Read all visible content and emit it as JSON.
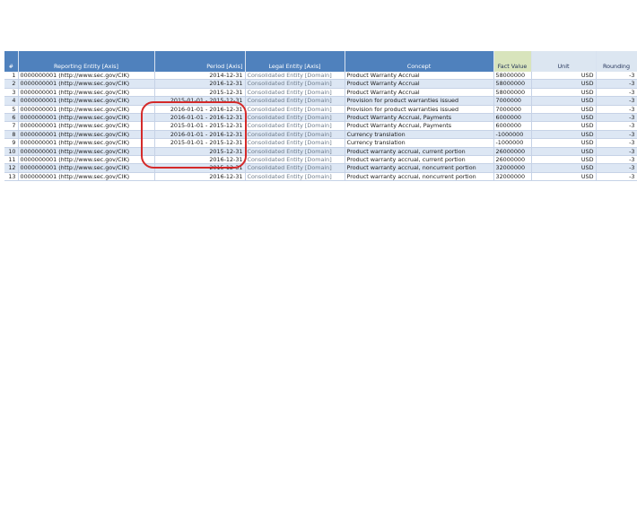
{
  "table": {
    "headers": [
      "#",
      "Reporting Entity [Axis]",
      "Period [Axis]",
      "Legal Entity [Axis]",
      "Concept",
      "Fact Value",
      "Unit",
      "Rounding"
    ],
    "rows": [
      {
        "n": "1",
        "entity": "0000000001 (http://www.sec.gov/CIK)",
        "period": "2014-12-31",
        "legal": "Consolidated Entity [Domain]",
        "concept": "Product Warranty Accrual",
        "value": "58000000",
        "unit": "USD",
        "rounding": "-3"
      },
      {
        "n": "2",
        "entity": "0000000001 (http://www.sec.gov/CIK)",
        "period": "2016-12-31",
        "legal": "Consolidated Entity [Domain]",
        "concept": "Product Warranty Accrual",
        "value": "58000000",
        "unit": "USD",
        "rounding": "-3"
      },
      {
        "n": "3",
        "entity": "0000000001 (http://www.sec.gov/CIK)",
        "period": "2015-12-31",
        "legal": "Consolidated Entity [Domain]",
        "concept": "Product Warranty Accrual",
        "value": "58000000",
        "unit": "USD",
        "rounding": "-3"
      },
      {
        "n": "4",
        "entity": "0000000001 (http://www.sec.gov/CIK)",
        "period": "2015-01-01 - 2015-12-31",
        "legal": "Consolidated Entity [Domain]",
        "concept": "Provision for product warranties issued",
        "value": "7000000",
        "unit": "USD",
        "rounding": "-3"
      },
      {
        "n": "5",
        "entity": "0000000001 (http://www.sec.gov/CIK)",
        "period": "2016-01-01 - 2016-12-31",
        "legal": "Consolidated Entity [Domain]",
        "concept": "Provision for product warranties issued",
        "value": "7000000",
        "unit": "USD",
        "rounding": "-3"
      },
      {
        "n": "6",
        "entity": "0000000001 (http://www.sec.gov/CIK)",
        "period": "2016-01-01 - 2016-12-31",
        "legal": "Consolidated Entity [Domain]",
        "concept": "Product Warranty Accrual, Payments",
        "value": "6000000",
        "unit": "USD",
        "rounding": "-3"
      },
      {
        "n": "7",
        "entity": "0000000001 (http://www.sec.gov/CIK)",
        "period": "2015-01-01 - 2015-12-31",
        "legal": "Consolidated Entity [Domain]",
        "concept": "Product Warranty Accrual, Payments",
        "value": "6000000",
        "unit": "USD",
        "rounding": "-3"
      },
      {
        "n": "8",
        "entity": "0000000001 (http://www.sec.gov/CIK)",
        "period": "2016-01-01 - 2016-12-31",
        "legal": "Consolidated Entity [Domain]",
        "concept": "Currency translation",
        "value": "-1000000",
        "unit": "USD",
        "rounding": "-3"
      },
      {
        "n": "9",
        "entity": "0000000001 (http://www.sec.gov/CIK)",
        "period": "2015-01-01 - 2015-12-31",
        "legal": "Consolidated Entity [Domain]",
        "concept": "Currency translation",
        "value": "-1000000",
        "unit": "USD",
        "rounding": "-3"
      },
      {
        "n": "10",
        "entity": "0000000001 (http://www.sec.gov/CIK)",
        "period": "2015-12-31",
        "legal": "Consolidated Entity [Domain]",
        "concept": "Product warranty accrual, current portion",
        "value": "26000000",
        "unit": "USD",
        "rounding": "-3"
      },
      {
        "n": "11",
        "entity": "0000000001 (http://www.sec.gov/CIK)",
        "period": "2016-12-31",
        "legal": "Consolidated Entity [Domain]",
        "concept": "Product warranty accrual, current portion",
        "value": "26000000",
        "unit": "USD",
        "rounding": "-3"
      },
      {
        "n": "12",
        "entity": "0000000001 (http://www.sec.gov/CIK)",
        "period": "2015-12-31",
        "legal": "Consolidated Entity [Domain]",
        "concept": "Product warranty accrual, noncurrent portion",
        "value": "32000000",
        "unit": "USD",
        "rounding": "-3"
      },
      {
        "n": "13",
        "entity": "0000000001 (http://www.sec.gov/CIK)",
        "period": "2016-12-31",
        "legal": "Consolidated Entity [Domain]",
        "concept": "Product warranty accrual, noncurrent portion",
        "value": "32000000",
        "unit": "USD",
        "rounding": "-3"
      }
    ]
  },
  "colors": {
    "header": "#4f81bd",
    "fact_header": "#d8e4bc",
    "band": "#dde7f4",
    "annotation": "#d42a2a"
  }
}
